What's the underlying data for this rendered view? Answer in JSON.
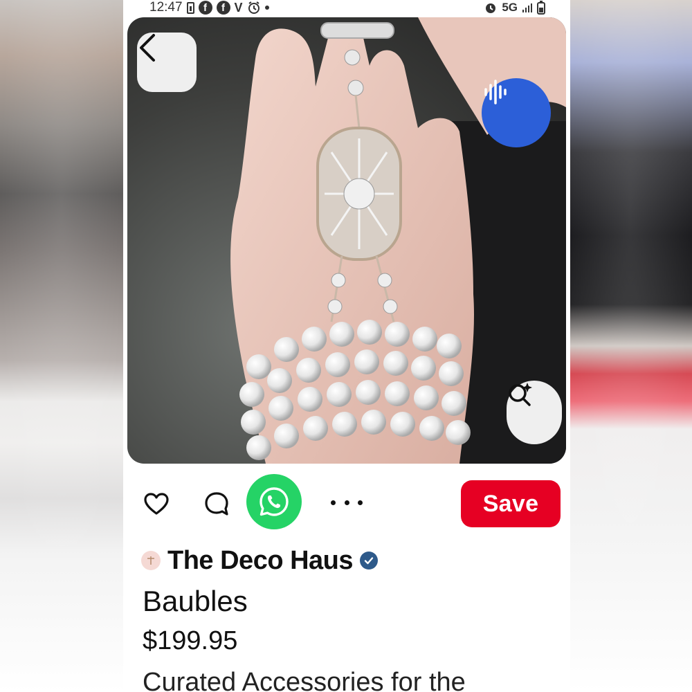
{
  "status_bar": {
    "time": "12:47",
    "network": "5G"
  },
  "icons": {
    "back": "chevron-left-icon",
    "voice": "audio-wave-icon",
    "lens": "visual-search-icon",
    "like": "heart-icon",
    "comment": "comment-bubble-icon",
    "share": "whatsapp-icon",
    "more": "more-dots-icon",
    "verified": "verified-check-icon"
  },
  "actions": {
    "save_label": "Save"
  },
  "pin": {
    "creator": "The Deco Haus",
    "title": "Baubles",
    "price": "$199.95",
    "description": "Curated Accessories for the"
  },
  "colors": {
    "save": "#e60023",
    "voice": "#2c5fd8",
    "whatsapp": "#25d366",
    "verified": "#2e5a8a"
  }
}
